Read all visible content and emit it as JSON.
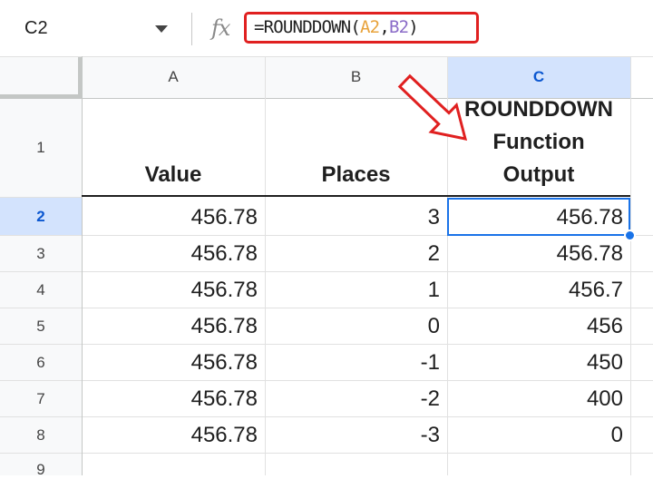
{
  "name_box": "C2",
  "formula": {
    "prefix": "=ROUNDDOWN(",
    "arg1": "A2",
    "comma": ",",
    "arg2": "B2",
    "suffix": ")"
  },
  "fx_label": "fx",
  "columns": [
    "A",
    "B",
    "C"
  ],
  "row_numbers": [
    "1",
    "2",
    "3",
    "4",
    "5",
    "6",
    "7",
    "8",
    "9"
  ],
  "headers": {
    "a": "Value",
    "b": "Places",
    "c": "ROUNDDOWN Function Output"
  },
  "rows": [
    {
      "a": "456.78",
      "b": "3",
      "c": "456.78"
    },
    {
      "a": "456.78",
      "b": "2",
      "c": "456.78"
    },
    {
      "a": "456.78",
      "b": "1",
      "c": "456.7"
    },
    {
      "a": "456.78",
      "b": "0",
      "c": "456"
    },
    {
      "a": "456.78",
      "b": "-1",
      "c": "450"
    },
    {
      "a": "456.78",
      "b": "-2",
      "c": "400"
    },
    {
      "a": "456.78",
      "b": "-3",
      "c": "0"
    }
  ],
  "colors": {
    "annotation": "#e02020",
    "selection": "#1a73e8",
    "header_selected": "#d3e3fd"
  }
}
